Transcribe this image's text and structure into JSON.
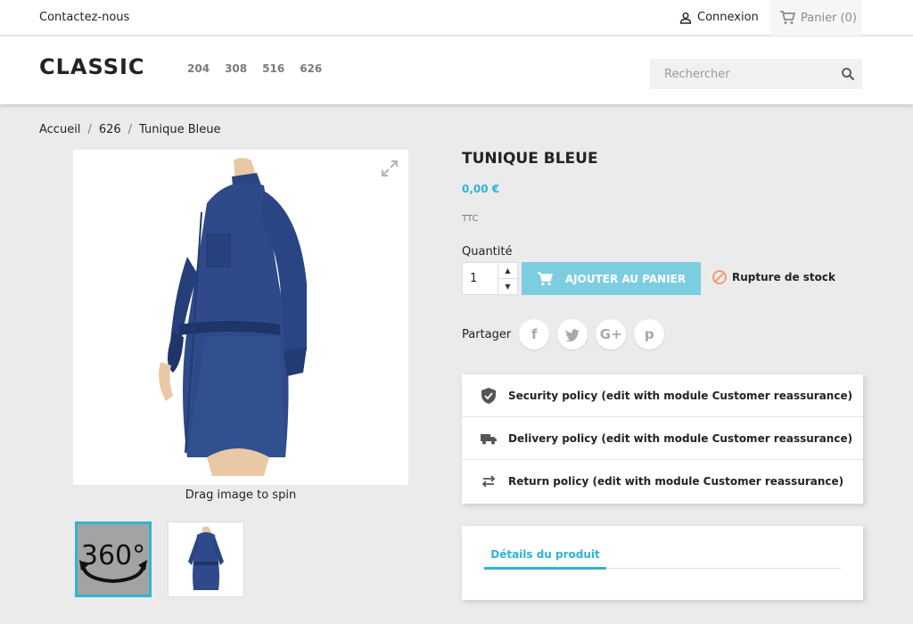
{
  "topbar": {
    "contact_label": "Contactez-nous",
    "login_label": "Connexion",
    "cart_label": "Panier (0)"
  },
  "header": {
    "logo": "CLASSIC",
    "menu": [
      "204",
      "308",
      "516",
      "626"
    ],
    "search_placeholder": "Rechercher"
  },
  "breadcrumb": {
    "items": [
      "Accueil",
      "626",
      "Tunique Bleue"
    ],
    "separator": "/"
  },
  "gallery": {
    "caption": "Drag image to spin",
    "spin_thumb_label": "360°"
  },
  "product": {
    "title": "TUNIQUE BLEUE",
    "price": "0,00 €",
    "tax_label": "TTC",
    "quantity_label": "Quantité",
    "quantity_value": "1",
    "add_to_cart_label": "AJOUTER AU PANIER",
    "stock_label": "Rupture de stock",
    "share_label": "Partager"
  },
  "social": [
    "f",
    "t",
    "G+",
    "p"
  ],
  "reassurance": [
    {
      "icon": "shield-icon",
      "label": "Security policy (edit with module Customer reassurance)"
    },
    {
      "icon": "truck-icon",
      "label": "Delivery policy (edit with module Customer reassurance)"
    },
    {
      "icon": "arrows-icon",
      "label": "Return policy (edit with module Customer reassurance)"
    }
  ],
  "tabs": {
    "details_label": "Détails du produit"
  },
  "colors": {
    "accent": "#2fb5d2",
    "button": "#7dcde0",
    "stock_icon": "#f39d72",
    "dress": "#2e4a8b"
  }
}
